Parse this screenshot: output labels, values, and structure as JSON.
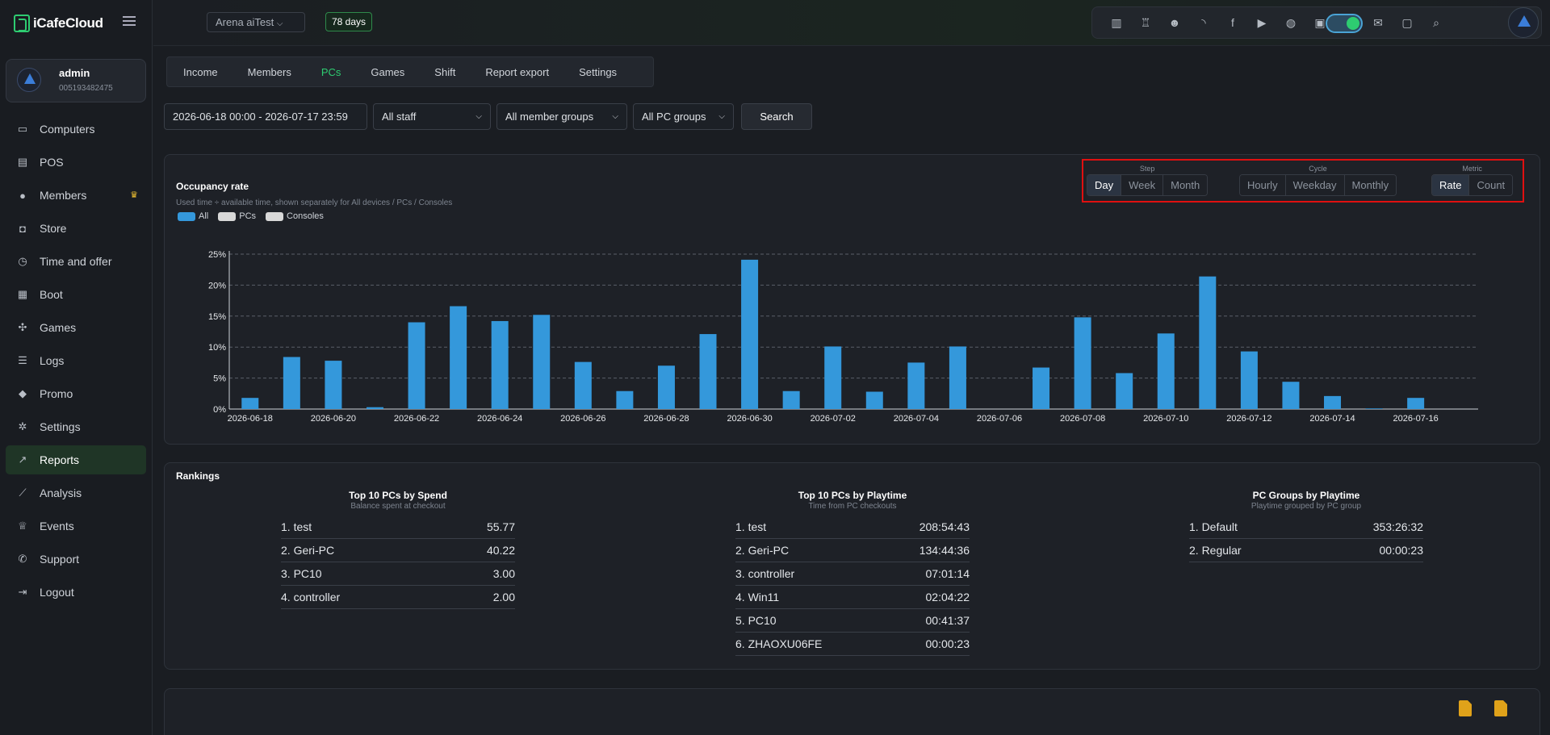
{
  "app": {
    "brand": "iCafeCloud"
  },
  "user": {
    "name": "admin",
    "id": "005193482475"
  },
  "sidebar": {
    "items": [
      {
        "label": "Computers",
        "icon": "monitor-icon"
      },
      {
        "label": "POS",
        "icon": "cash-register-icon"
      },
      {
        "label": "Members",
        "icon": "users-icon"
      },
      {
        "label": "Store",
        "icon": "bag-icon"
      },
      {
        "label": "Time and offer",
        "icon": "stopwatch-icon"
      },
      {
        "label": "Boot",
        "icon": "windows-icon"
      },
      {
        "label": "Games",
        "icon": "gamepad-icon"
      },
      {
        "label": "Logs",
        "icon": "list-icon"
      },
      {
        "label": "Promo",
        "icon": "tag-icon"
      },
      {
        "label": "Settings",
        "icon": "gear-icon"
      },
      {
        "label": "Reports",
        "icon": "chart-line-icon",
        "active": true
      },
      {
        "label": "Analysis",
        "icon": "analysis-icon"
      },
      {
        "label": "Events",
        "icon": "crown-icon"
      },
      {
        "label": "Support",
        "icon": "phone-icon"
      },
      {
        "label": "Logout",
        "icon": "logout-icon"
      }
    ]
  },
  "topbar": {
    "store": "Arena aiTest",
    "days": "78 days",
    "icons": [
      "leaderboard-icon",
      "trophy-icon",
      "group-icon",
      "rss-icon",
      "facebook-icon",
      "youtube-icon",
      "globe-icon",
      "icafe-icon",
      "logo-icon",
      "mail-icon",
      "chat-icon",
      "search-icon"
    ]
  },
  "tabs": [
    {
      "label": "Income"
    },
    {
      "label": "Members"
    },
    {
      "label": "PCs",
      "active": true
    },
    {
      "label": "Games"
    },
    {
      "label": "Shift"
    },
    {
      "label": "Report export"
    },
    {
      "label": "Settings"
    }
  ],
  "filters": {
    "date_range": "2026-06-18 00:00 - 2026-07-17 23:59",
    "staff": "All staff",
    "member_groups": "All member groups",
    "pc_groups": "All PC groups",
    "search_label": "Search"
  },
  "occupancy": {
    "title": "Occupancy rate",
    "subtitle": "Used time ÷ available time, shown separately for All devices / PCs / Consoles",
    "legend": [
      {
        "label": "All",
        "color": "#3498db"
      },
      {
        "label": "PCs",
        "color": "#d8d8d8"
      },
      {
        "label": "Consoles",
        "color": "#d8d8d8"
      }
    ],
    "controls": {
      "step": {
        "label": "Step",
        "options": [
          "Day",
          "Week",
          "Month"
        ],
        "selected": "Day"
      },
      "cycle": {
        "label": "Cycle",
        "options": [
          "Hourly",
          "Weekday",
          "Monthly"
        ],
        "selected": ""
      },
      "metric": {
        "label": "Metric",
        "options": [
          "Rate",
          "Count"
        ],
        "selected": "Rate"
      }
    }
  },
  "chart_data": {
    "type": "bar",
    "title": "",
    "xlabel": "",
    "ylabel": "",
    "bar_color": "#3498db",
    "ylim": [
      0,
      25
    ],
    "yticks": [
      "0%",
      "5%",
      "10%",
      "15%",
      "20%",
      "25%"
    ],
    "categories": [
      "2026-06-18",
      "2026-06-19",
      "2026-06-20",
      "2026-06-21",
      "2026-06-22",
      "2026-06-23",
      "2026-06-24",
      "2026-06-25",
      "2026-06-26",
      "2026-06-27",
      "2026-06-28",
      "2026-06-29",
      "2026-06-30",
      "2026-07-01",
      "2026-07-02",
      "2026-07-03",
      "2026-07-04",
      "2026-07-05",
      "2026-07-06",
      "2026-07-07",
      "2026-07-08",
      "2026-07-09",
      "2026-07-10",
      "2026-07-11",
      "2026-07-12",
      "2026-07-13",
      "2026-07-14",
      "2026-07-15",
      "2026-07-16",
      "2026-07-17"
    ],
    "xtick_labels": [
      "2026-06-18",
      "2026-06-20",
      "2026-06-22",
      "2026-06-24",
      "2026-06-26",
      "2026-06-28",
      "2026-06-30",
      "2026-07-02",
      "2026-07-04",
      "2026-07-06",
      "2026-07-08",
      "2026-07-10",
      "2026-07-12",
      "2026-07-14",
      "2026-07-16"
    ],
    "values": [
      1.8,
      8.4,
      7.8,
      0.3,
      14.0,
      16.6,
      14.2,
      15.2,
      7.6,
      2.9,
      7.0,
      12.1,
      24.1,
      2.9,
      10.1,
      2.8,
      7.5,
      10.1,
      0,
      6.7,
      14.8,
      5.8,
      12.2,
      21.4,
      9.3,
      4.4,
      2.1,
      0.1,
      1.8,
      0
    ]
  },
  "rankings": {
    "title": "Rankings",
    "columns": [
      {
        "head": "Top 10 PCs by Spend",
        "sub": "Balance spent at checkout",
        "rows": [
          {
            "name": "1. test",
            "value": "55.77"
          },
          {
            "name": "2. Geri-PC",
            "value": "40.22"
          },
          {
            "name": "3. PC10",
            "value": "3.00"
          },
          {
            "name": "4. controller",
            "value": "2.00"
          }
        ]
      },
      {
        "head": "Top 10 PCs by Playtime",
        "sub": "Time from PC checkouts",
        "rows": [
          {
            "name": "1. test",
            "value": "208:54:43"
          },
          {
            "name": "2. Geri-PC",
            "value": "134:44:36"
          },
          {
            "name": "3. controller",
            "value": "07:01:14"
          },
          {
            "name": "4. Win11",
            "value": "02:04:22"
          },
          {
            "name": "5. PC10",
            "value": "00:41:37"
          },
          {
            "name": "6. ZHAOXU06FE",
            "value": "00:00:23"
          }
        ]
      },
      {
        "head": "PC Groups by Playtime",
        "sub": "Playtime grouped by PC group",
        "rows": [
          {
            "name": "1. Default",
            "value": "353:26:32"
          },
          {
            "name": "2. Regular",
            "value": "00:00:23"
          }
        ]
      }
    ]
  },
  "export": {
    "icons": [
      "pdf-icon",
      "excel-icon"
    ]
  }
}
